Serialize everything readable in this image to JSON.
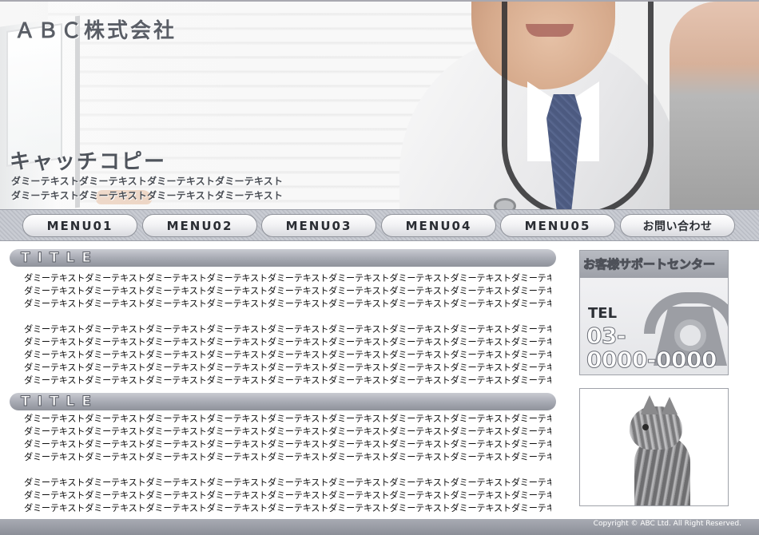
{
  "header": {
    "company": "ＡＢＣ株式会社",
    "catchcopy": "キャッチコピー",
    "subtext": [
      "ダミーテキストダミーテキストダミーテキストダミーテキスト",
      "ダミーテキストダミーテキストダミーテキストダミーテキスト"
    ]
  },
  "nav": [
    {
      "label": "MENU01"
    },
    {
      "label": "MENU02"
    },
    {
      "label": "MENU03"
    },
    {
      "label": "MENU04"
    },
    {
      "label": "MENU05"
    },
    {
      "label": "お問い合わせ"
    }
  ],
  "sections": [
    {
      "title": "TITLE",
      "paragraphs": [
        [
          "ダミーテキストダミーテキストダミーテキストダミーテキストダミーテキストダミーテキストダミーテキストダミーテキストダミーテキスト",
          "ダミーテキストダミーテキストダミーテキストダミーテキストダミーテキストダミーテキストダミーテキストダミーテキストダミーテキスト",
          "ダミーテキストダミーテキストダミーテキストダミーテキストダミーテキストダミーテキストダミーテキストダミーテキストダミーテキスト"
        ],
        [
          "ダミーテキストダミーテキストダミーテキストダミーテキストダミーテキストダミーテキストダミーテキストダミーテキストダミーテキスト",
          "ダミーテキストダミーテキストダミーテキストダミーテキストダミーテキストダミーテキストダミーテキストダミーテキストダミーテキスト",
          "ダミーテキストダミーテキストダミーテキストダミーテキストダミーテキストダミーテキストダミーテキストダミーテキストダミーテキスト",
          "ダミーテキストダミーテキストダミーテキストダミーテキストダミーテキストダミーテキストダミーテキストダミーテキストダミーテキスト",
          "ダミーテキストダミーテキストダミーテキストダミーテキストダミーテキストダミーテキストダミーテキストダミーテキストダミーテキスト"
        ]
      ]
    },
    {
      "title": "TITLE",
      "paragraphs": [
        [
          "ダミーテキストダミーテキストダミーテキストダミーテキストダミーテキストダミーテキストダミーテキストダミーテキストダミーテキスト",
          "ダミーテキストダミーテキストダミーテキストダミーテキストダミーテキストダミーテキストダミーテキストダミーテキストダミーテキスト",
          "ダミーテキストダミーテキストダミーテキストダミーテキストダミーテキストダミーテキストダミーテキストダミーテキストダミーテキスト",
          "ダミーテキストダミーテキストダミーテキストダミーテキストダミーテキストダミーテキストダミーテキストダミーテキストダミーテキスト"
        ],
        [
          "ダミーテキストダミーテキストダミーテキストダミーテキストダミーテキストダミーテキストダミーテキストダミーテキストダミーテキスト",
          "ダミーテキストダミーテキストダミーテキストダミーテキストダミーテキストダミーテキストダミーテキストダミーテキストダミーテキスト",
          "ダミーテキストダミーテキストダミーテキストダミーテキストダミーテキストダミーテキストダミーテキストダミーテキストダミーテキスト"
        ]
      ]
    }
  ],
  "sidebar": {
    "support_title": "お客様サポートセンター",
    "tel_label": "TEL",
    "tel_number_line1": "03-",
    "tel_number_line2": "0000-0000",
    "icons": {
      "support": "telephone-icon",
      "photo": "kitten-photo"
    }
  },
  "footer": {
    "copyright": "Copyright © ABC Ltd. All Right Reserved."
  },
  "colors": {
    "accent_gray": "#a8abb4",
    "nav_text": "#2a2d33",
    "heading_text": "#4f545c"
  }
}
